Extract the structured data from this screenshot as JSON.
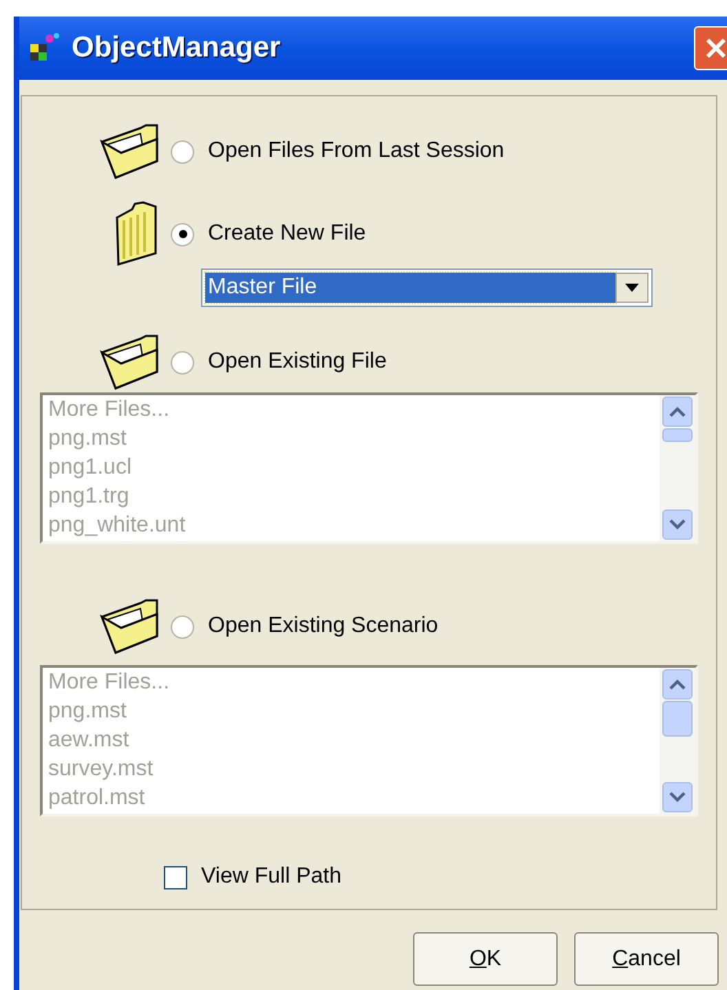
{
  "window": {
    "title": "ObjectManager"
  },
  "options": [
    {
      "label": "Open Files From Last Session",
      "selected": false
    },
    {
      "label": "Create New File",
      "selected": true,
      "dropdown": {
        "value": "Master File"
      }
    },
    {
      "label": "Open Existing File",
      "selected": false,
      "list": [
        "More Files...",
        "png.mst",
        "png1.ucl",
        "png1.trg",
        "png_white.unt"
      ]
    },
    {
      "label": "Open Existing Scenario",
      "selected": false,
      "list": [
        "More Files...",
        "png.mst",
        "aew.mst",
        "survey.mst",
        "patrol.mst"
      ]
    }
  ],
  "view_full_path": {
    "label": "View Full Path",
    "checked": false
  },
  "buttons": [
    "OK",
    "Cancel"
  ]
}
